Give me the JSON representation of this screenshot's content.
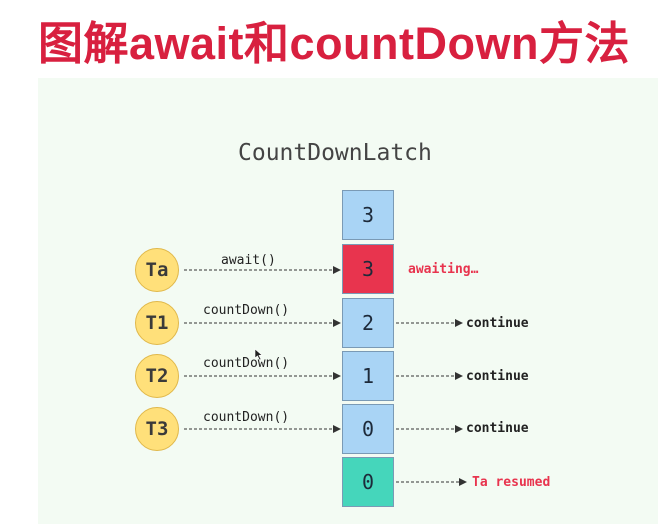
{
  "title": "图解await和countDown方法",
  "diagram": {
    "latch_name": "CountDownLatch",
    "colors": {
      "count_cell": "#a9d4f5",
      "waiting_cell": "#e8344e",
      "resumed_cell": "#45d6bb",
      "thread": "#ffe07a",
      "status_red": "#e8344e"
    },
    "initial_count": "3",
    "rows": [
      {
        "thread": "Ta",
        "call": "await()",
        "count": "3",
        "status": "awaiting…"
      },
      {
        "thread": "T1",
        "call": "countDown()",
        "count": "2",
        "status": "continue"
      },
      {
        "thread": "T2",
        "call": "countDown()",
        "count": "1",
        "status": "continue"
      },
      {
        "thread": "T3",
        "call": "countDown()",
        "count": "0",
        "status": "continue"
      }
    ],
    "final": {
      "count": "0",
      "status": "Ta resumed"
    }
  }
}
